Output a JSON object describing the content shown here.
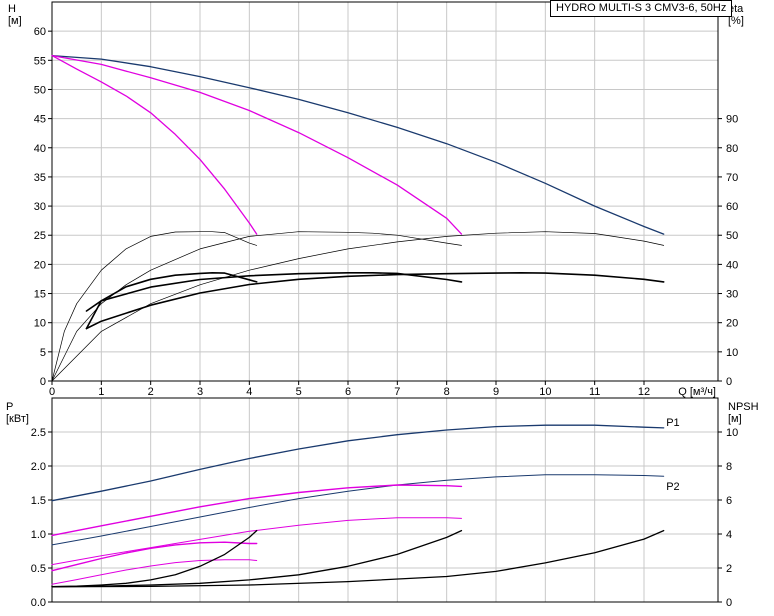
{
  "chart_data": [
    {
      "type": "line",
      "title": "HYDRO MULTI-S 3 CMV3-6, 50Hz",
      "xlabel": "Q [м³/ч]",
      "ylabel": "H\n[м]",
      "y2label": "eta\n[%]",
      "xlim": [
        0,
        13.5
      ],
      "ylim": [
        0,
        65
      ],
      "y2lim": [
        0,
        130
      ],
      "xticks": [
        0,
        1,
        2,
        3,
        4,
        5,
        6,
        7,
        8,
        9,
        10,
        11,
        12
      ],
      "yticks": [
        0,
        5,
        10,
        15,
        20,
        25,
        30,
        35,
        40,
        45,
        50,
        55,
        60
      ],
      "y2ticks": [
        0,
        10,
        20,
        30,
        40,
        50,
        60,
        70,
        80,
        90
      ],
      "grid": true,
      "colors": {
        "head_total": "#1a3a6e",
        "head_single": "#e000e0",
        "eta": "#000000"
      },
      "series": [
        {
          "axis": "y",
          "style": "head_total",
          "x": [
            0,
            1,
            2,
            3,
            4,
            5,
            6,
            7,
            8,
            9,
            10,
            11,
            12,
            12.4
          ],
          "values": [
            55.8,
            55.2,
            53.9,
            52.2,
            50.3,
            48.3,
            46.0,
            43.5,
            40.7,
            37.5,
            33.9,
            30.0,
            26.5,
            25.2
          ]
        },
        {
          "axis": "y",
          "style": "head_single",
          "x": [
            0,
            1,
            2,
            3,
            4,
            5,
            6,
            7,
            8,
            8.3
          ],
          "values": [
            55.8,
            54.3,
            52.0,
            49.5,
            46.4,
            42.6,
            38.3,
            33.6,
            27.9,
            25.2
          ]
        },
        {
          "axis": "y",
          "style": "head_single",
          "x": [
            0,
            0.5,
            1,
            1.5,
            2,
            2.5,
            3,
            3.5,
            4,
            4.15
          ],
          "values": [
            55.8,
            53.5,
            51.3,
            48.9,
            46.0,
            42.3,
            38.0,
            32.9,
            27.1,
            25.2
          ]
        },
        {
          "axis": "y2",
          "style": "eta",
          "width": 0.7,
          "x": [
            0,
            1,
            2,
            3,
            4,
            5,
            6,
            7,
            8,
            9,
            10,
            11,
            12,
            12.4
          ],
          "values": [
            0,
            17,
            26.5,
            33,
            38,
            42,
            45.3,
            47.7,
            49.6,
            50.7,
            51.2,
            50.6,
            48.0,
            46.5
          ]
        },
        {
          "axis": "y2",
          "style": "eta",
          "width": 0.7,
          "x": [
            0,
            0.5,
            1,
            1.5,
            2,
            3,
            4,
            5,
            6,
            6.5,
            7,
            8,
            8.3
          ],
          "values": [
            0,
            17,
            26.5,
            33,
            38,
            45.3,
            49.6,
            51.2,
            51.0,
            50.7,
            50.0,
            47.3,
            46.5
          ]
        },
        {
          "axis": "y2",
          "style": "eta",
          "width": 0.7,
          "x": [
            0,
            0.25,
            0.5,
            1,
            1.5,
            2,
            2.5,
            3,
            3.25,
            3.5,
            4,
            4.15
          ],
          "values": [
            0,
            17,
            26.5,
            38,
            45.3,
            49.6,
            51.1,
            51.2,
            51.2,
            50.9,
            47.3,
            46.5
          ]
        },
        {
          "axis": "y2",
          "style": "eta",
          "width": 1.6,
          "x": [
            0.7,
            1,
            2,
            3,
            4,
            5,
            6,
            7,
            8,
            9,
            9.5,
            10,
            11,
            12,
            12.4
          ],
          "values": [
            18,
            20.5,
            26,
            30.2,
            33.1,
            34.9,
            35.9,
            36.5,
            36.8,
            37.0,
            37.1,
            37.0,
            36.3,
            34.9,
            34.0
          ]
        },
        {
          "axis": "y2",
          "style": "eta",
          "width": 1.6,
          "x": [
            0.7,
            1,
            2,
            3,
            4,
            5,
            6,
            6.5,
            7,
            8,
            8.3
          ],
          "values": [
            24,
            27.5,
            32.2,
            34.8,
            36.1,
            36.8,
            37.1,
            37.1,
            36.9,
            34.8,
            34.0
          ]
        },
        {
          "axis": "y2",
          "style": "eta",
          "width": 1.6,
          "x": [
            0.7,
            1,
            1.5,
            2,
            2.5,
            3,
            3.25,
            3.5,
            4,
            4.15
          ],
          "values": [
            18,
            27.5,
            32.3,
            34.9,
            36.3,
            36.9,
            37.1,
            37.0,
            34.7,
            34.0
          ]
        }
      ]
    },
    {
      "type": "line",
      "ylabel": "P\n[кВт]",
      "y2label": "NPSH\n[м]",
      "xlim": [
        0,
        13.5
      ],
      "ylim": [
        0,
        3.0
      ],
      "y2lim": [
        0,
        12
      ],
      "yticks": [
        0.0,
        0.5,
        1.0,
        1.5,
        2.0,
        2.5
      ],
      "ytick_labels": [
        "0.0",
        "0.5",
        "1.0",
        "1.5",
        "2.0",
        "2.5"
      ],
      "y2ticks": [
        0,
        2,
        4,
        6,
        8,
        10
      ],
      "grid": true,
      "colors": {
        "power_total": "#1a3a6e",
        "power_single": "#e000e0",
        "npsh": "#000000"
      },
      "annotations": [
        {
          "text": "P1",
          "x": 12.45,
          "y": 2.63
        },
        {
          "text": "P2",
          "x": 12.45,
          "y": 1.69
        }
      ],
      "series": [
        {
          "name": "P1",
          "axis": "y",
          "style": "power_total",
          "width": 1.3,
          "x": [
            0,
            1,
            2,
            3,
            4,
            5,
            6,
            7,
            8,
            9,
            10,
            11,
            12,
            12.4
          ],
          "values": [
            1.49,
            1.63,
            1.78,
            1.95,
            2.11,
            2.25,
            2.37,
            2.46,
            2.53,
            2.58,
            2.6,
            2.6,
            2.57,
            2.56
          ]
        },
        {
          "name": "P2",
          "axis": "y",
          "style": "power_total",
          "width": 1.0,
          "x": [
            0,
            1,
            2,
            3,
            4,
            5,
            6,
            7,
            8,
            9,
            10,
            11,
            12,
            12.4
          ],
          "values": [
            0.84,
            0.97,
            1.11,
            1.25,
            1.39,
            1.52,
            1.63,
            1.72,
            1.79,
            1.84,
            1.87,
            1.87,
            1.86,
            1.85
          ]
        },
        {
          "axis": "y",
          "style": "power_single",
          "width": 1.4,
          "x": [
            0,
            1,
            2,
            3,
            4,
            5,
            6,
            7,
            8,
            8.3
          ],
          "values": [
            0.98,
            1.12,
            1.26,
            1.4,
            1.52,
            1.61,
            1.68,
            1.72,
            1.71,
            1.7
          ]
        },
        {
          "axis": "y",
          "style": "power_single",
          "width": 1.0,
          "x": [
            0,
            1,
            2,
            3,
            4,
            5,
            6,
            7,
            8,
            8.3
          ],
          "values": [
            0.55,
            0.68,
            0.8,
            0.92,
            1.04,
            1.13,
            1.2,
            1.24,
            1.24,
            1.23
          ]
        },
        {
          "axis": "y",
          "style": "power_single",
          "width": 1.4,
          "x": [
            0,
            0.5,
            1,
            1.5,
            2,
            2.5,
            3,
            3.5,
            4,
            4.15
          ],
          "values": [
            0.46,
            0.55,
            0.64,
            0.72,
            0.79,
            0.84,
            0.87,
            0.88,
            0.86,
            0.86
          ]
        },
        {
          "axis": "y",
          "style": "power_single",
          "width": 1.0,
          "x": [
            0,
            0.5,
            1,
            1.5,
            2,
            2.5,
            3,
            3.5,
            4,
            4.15
          ],
          "values": [
            0.26,
            0.33,
            0.4,
            0.47,
            0.53,
            0.58,
            0.61,
            0.62,
            0.62,
            0.61
          ]
        },
        {
          "axis": "y2",
          "style": "npsh",
          "width": 1.3,
          "x": [
            0,
            2,
            4,
            6,
            8,
            9,
            10,
            11,
            12,
            12.4
          ],
          "values": [
            0.9,
            0.92,
            1.0,
            1.2,
            1.5,
            1.8,
            2.3,
            2.9,
            3.7,
            4.2
          ]
        },
        {
          "axis": "y2",
          "style": "npsh",
          "width": 1.3,
          "x": [
            0,
            1,
            2,
            3,
            4,
            5,
            6,
            7,
            7.5,
            8,
            8.3
          ],
          "values": [
            0.9,
            0.93,
            1.0,
            1.1,
            1.3,
            1.6,
            2.1,
            2.8,
            3.3,
            3.8,
            4.2
          ]
        },
        {
          "axis": "y2",
          "style": "npsh",
          "width": 1.3,
          "x": [
            0,
            0.5,
            1,
            1.5,
            2,
            2.5,
            3,
            3.5,
            4,
            4.15
          ],
          "values": [
            0.9,
            0.93,
            1.0,
            1.1,
            1.3,
            1.6,
            2.1,
            2.8,
            3.8,
            4.2
          ]
        }
      ]
    }
  ]
}
